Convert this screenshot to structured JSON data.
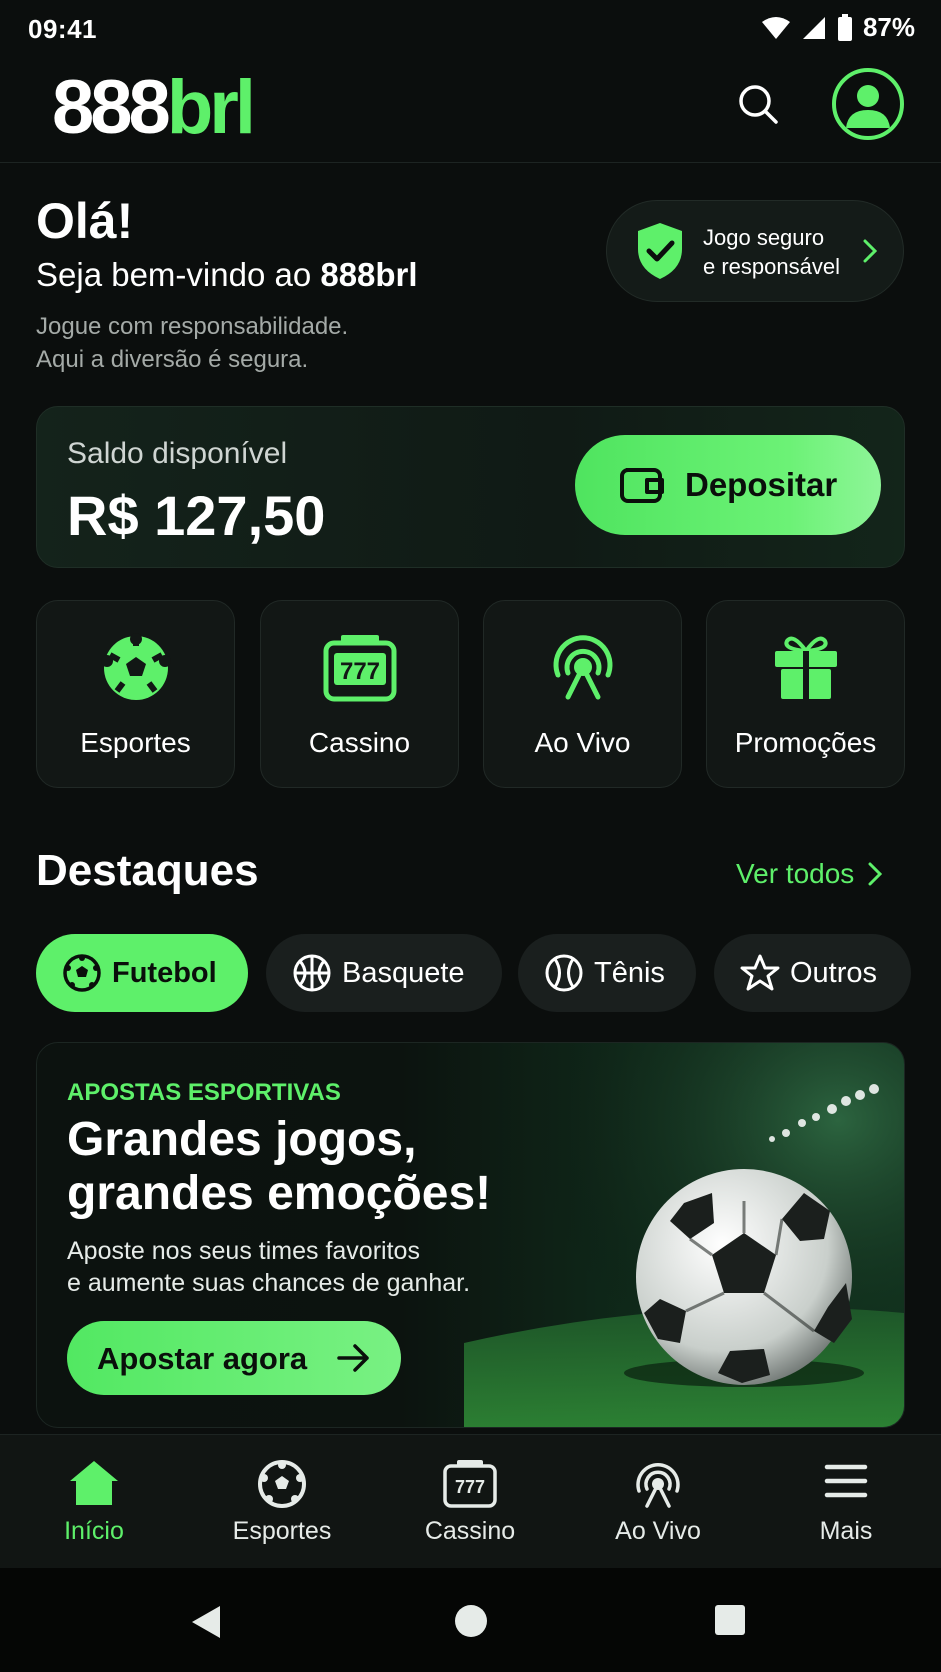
{
  "status": {
    "time": "09:41",
    "battery": "87%"
  },
  "header": {
    "logo_main": "888",
    "logo_accent": "brl"
  },
  "greeting": {
    "hello": "Olá!",
    "welcome_prefix": "Seja bem-vindo ao ",
    "welcome_brand": "888brl",
    "line1": "Jogue com responsabilidade.",
    "line2": "Aqui a diversão é segura."
  },
  "safe_badge": {
    "line1": "Jogo seguro",
    "line2": "e responsável"
  },
  "balance": {
    "label": "Saldo disponível",
    "value": "R$ 127,50",
    "deposit_label": "Depositar"
  },
  "categories": [
    {
      "label": "Esportes",
      "icon": "soccer-ball-icon"
    },
    {
      "label": "Cassino",
      "icon": "slot-machine-icon"
    },
    {
      "label": "Ao Vivo",
      "icon": "live-broadcast-icon"
    },
    {
      "label": "Promoções",
      "icon": "gift-icon"
    }
  ],
  "highlights": {
    "title": "Destaques",
    "see_all": "Ver todos",
    "chips": [
      {
        "label": "Futebol",
        "icon": "soccer-ball-icon",
        "active": true
      },
      {
        "label": "Basquete",
        "icon": "basketball-icon",
        "active": false
      },
      {
        "label": "Tênis",
        "icon": "tennis-ball-icon",
        "active": false
      },
      {
        "label": "Outros",
        "icon": "star-icon",
        "active": false
      }
    ]
  },
  "banner": {
    "kicker": "APOSTAS ESPORTIVAS",
    "headline_1": "Grandes jogos,",
    "headline_2": "grandes emoções!",
    "text_1": "Aposte nos seus times favoritos",
    "text_2": "e aumente suas chances de ganhar.",
    "cta": "Apostar agora"
  },
  "bottom_nav": [
    {
      "label": "Início",
      "icon": "home-icon",
      "active": true
    },
    {
      "label": "Esportes",
      "icon": "soccer-ball-icon",
      "active": false
    },
    {
      "label": "Cassino",
      "icon": "slot-machine-icon",
      "active": false
    },
    {
      "label": "Ao Vivo",
      "icon": "live-broadcast-icon",
      "active": false
    },
    {
      "label": "Mais",
      "icon": "menu-icon",
      "active": false
    }
  ],
  "colors": {
    "accent": "#5ef06a",
    "background": "#0b0e0d",
    "card": "#121715"
  }
}
